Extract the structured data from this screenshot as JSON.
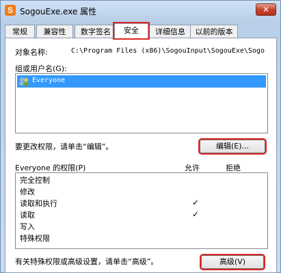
{
  "window": {
    "title": "SogouExe.exe 属性",
    "close_label": "✕",
    "app_icon_glyph": "S"
  },
  "tabs": [
    {
      "label": "常规"
    },
    {
      "label": "兼容性"
    },
    {
      "label": "数字签名"
    },
    {
      "label": "安全"
    },
    {
      "label": "详细信息"
    },
    {
      "label": "以前的版本"
    }
  ],
  "security": {
    "object_name_label": "对象名称:",
    "object_name_value": "C:\\Program Files (x86)\\SogouInput\\SogouExe\\Sogo",
    "groups_label": "组或用户名(G):",
    "groups": [
      {
        "name": "Everyone",
        "icon": "users-icon"
      }
    ],
    "change_perm_text": "要更改权限，请单击“编辑”。",
    "edit_button": "编辑(E)...",
    "perm_header": "Everyone 的权限(P)",
    "allow_header": "允许",
    "deny_header": "拒绝",
    "permissions": [
      {
        "name": "完全控制",
        "allow": "",
        "deny": ""
      },
      {
        "name": "修改",
        "allow": "",
        "deny": ""
      },
      {
        "name": "读取和执行",
        "allow": "✓",
        "deny": ""
      },
      {
        "name": "读取",
        "allow": "✓",
        "deny": ""
      },
      {
        "name": "写入",
        "allow": "",
        "deny": ""
      },
      {
        "name": "特殊权限",
        "allow": "",
        "deny": ""
      }
    ],
    "advanced_text": "有关特殊权限或高级设置，请单击“高级”。",
    "advanced_button": "高级(V)"
  },
  "colors": {
    "highlight": "#e02424",
    "selection": "#3399ff"
  }
}
